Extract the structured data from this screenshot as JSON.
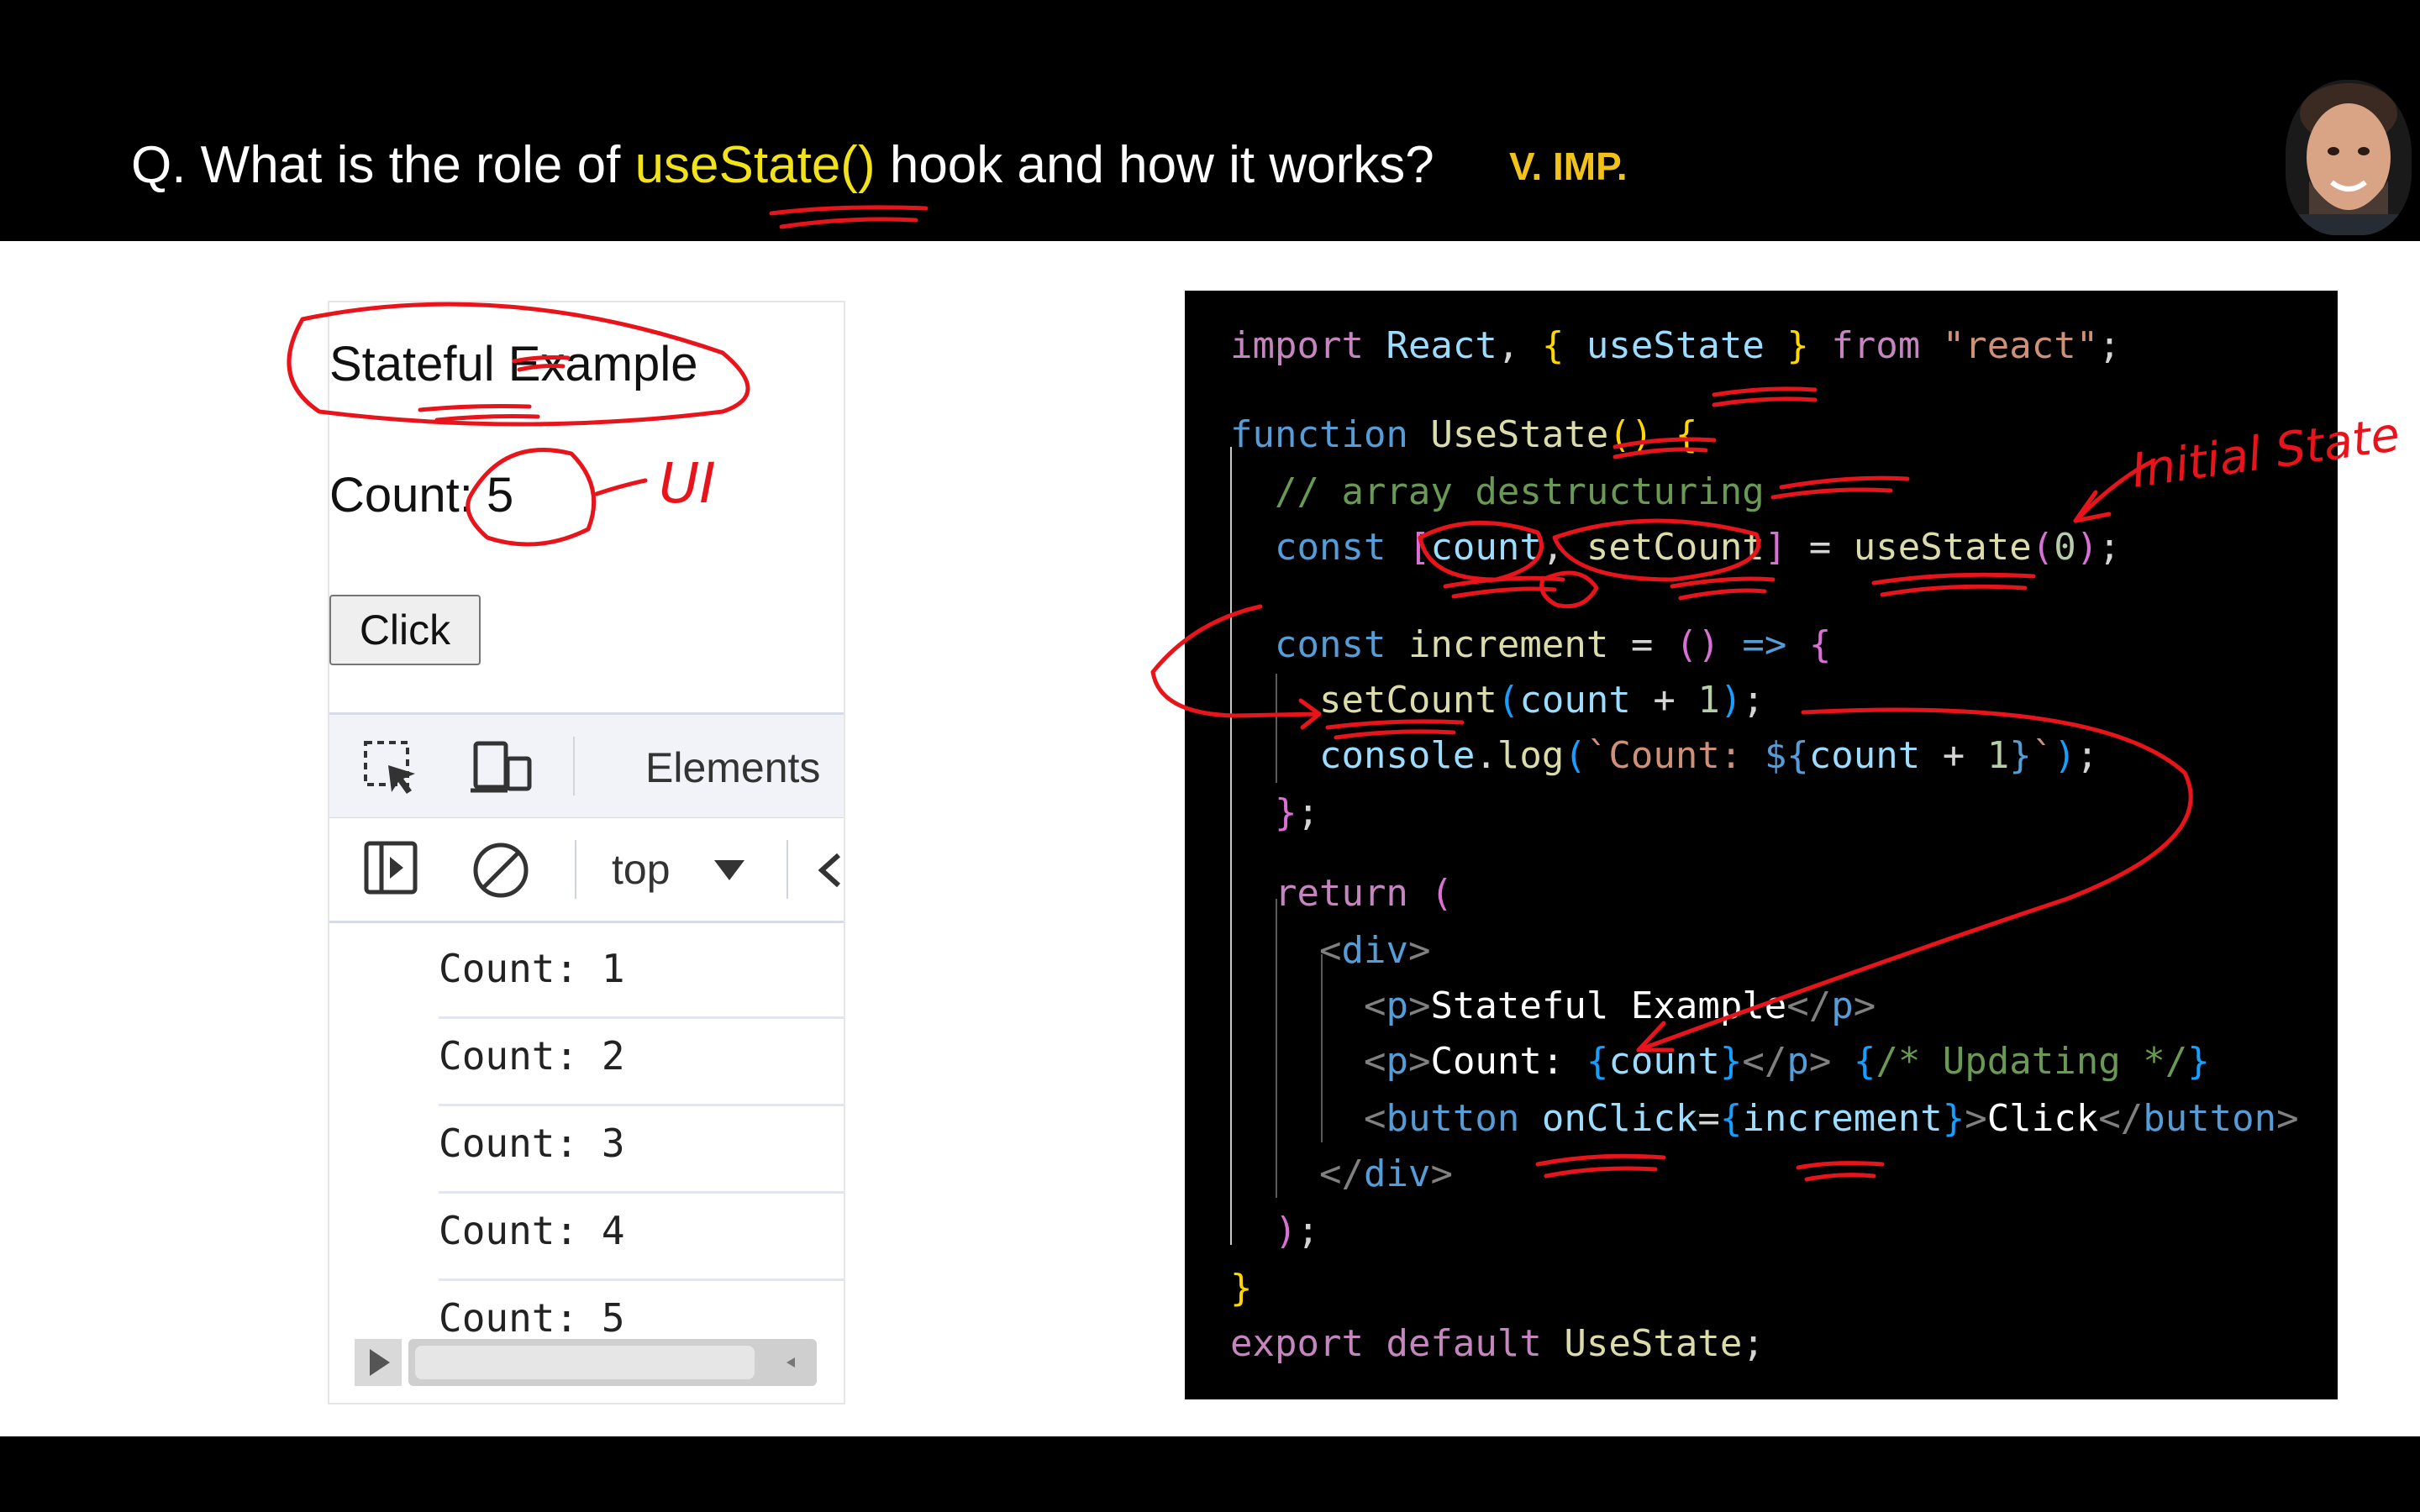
{
  "header": {
    "question_prefix": "Q. What is the role of ",
    "question_highlight": "useState()",
    "question_suffix": " hook and how it works?",
    "badge": "V. IMP."
  },
  "browser": {
    "app_title": "Stateful Example",
    "count_text": "Count: 5",
    "button_label": "Click",
    "devtools": {
      "tab_elements": "Elements",
      "context_select": "top"
    },
    "console_lines": [
      "Count: 1",
      "Count: 2",
      "Count: 3",
      "Count: 4",
      "Count: 5"
    ]
  },
  "code_lines": [
    "import React, { useState } from \"react\";",
    "",
    "function UseState() {",
    "  // array destructuring",
    "  const [count, setCount] = useState(0);",
    "",
    "  const increment = () => {",
    "    setCount(count + 1);",
    "    console.log(`Count: ${count + 1}`);",
    "  };",
    "",
    "  return (",
    "    <div>",
    "      <p>Stateful Example</p>",
    "      <p>Count: {count}</p> {/* Updating */}",
    "      <button onClick={increment}>Click</button>",
    "    </div>",
    "  );",
    "}",
    "export default UseState;"
  ],
  "annotations": {
    "ui_note": "UI",
    "initial_state_note": "Initial State"
  },
  "colors": {
    "highlight": "#f2e21c",
    "badge": "#f2c21c",
    "ink": "#e8141c"
  }
}
